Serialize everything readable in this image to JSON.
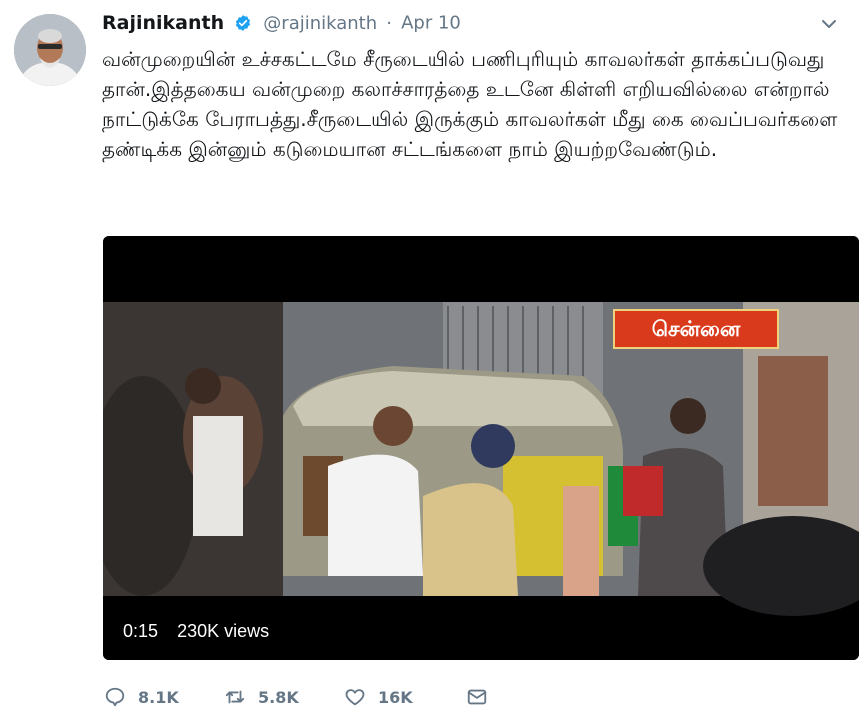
{
  "tweet": {
    "author_name": "Rajinikanth",
    "handle": "@rajinikanth",
    "separator": "·",
    "date": "Apr 10",
    "text": "வன்முறையின் உச்சகட்டமே சீருடையில் பணிபுரியும் காவலர்கள் தாக்கப்படுவது தான்.இத்தகைய வன்முறை கலாச்சாரத்தை உடனே கிள்ளி எறியவில்லை என்றால் நாட்டுக்கே பேராபத்து.சீருடையில் இருக்கும் காவலர்கள் மீது கை வைப்பவர்களை தண்டிக்க இன்னும் கடுமையான சட்டங்களை நாம் இயற்றவேண்டும்.",
    "icons": {
      "verified": "verified-badge-icon",
      "more": "chevron-down-icon"
    }
  },
  "video": {
    "overlay_tag": "சென்னை",
    "time": "0:15",
    "views": "230K views"
  },
  "actions": {
    "reply_count": "8.1K",
    "retweet_count": "5.8K",
    "like_count": "16K"
  },
  "colors": {
    "accent": "#1da1f2",
    "muted": "#657786",
    "tag_red": "#d93a1c"
  }
}
